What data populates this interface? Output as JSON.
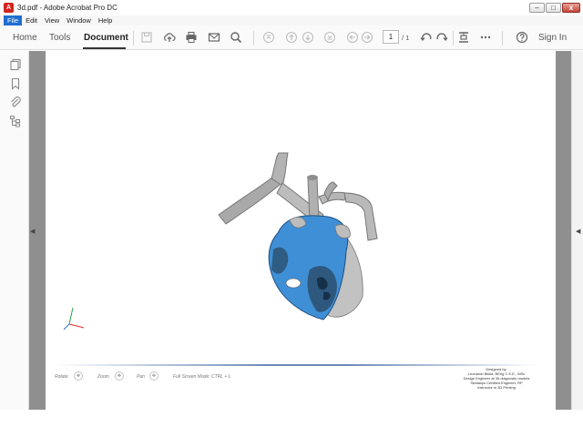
{
  "window": {
    "title": "3d.pdf - Adobe Acrobat Pro DC"
  },
  "menu": {
    "items": [
      "File",
      "Edit",
      "View",
      "Window",
      "Help"
    ]
  },
  "toolbar": {
    "home": "Home",
    "tools": "Tools",
    "document": "Document",
    "page_current": "1",
    "page_total": "/ 1",
    "signin": "Sign In"
  },
  "viewer": {
    "hints": {
      "rotate": "Rotate",
      "zoom": "Zoom",
      "pan": "Pan",
      "fullscreen": "Full Screen Mode: CTRL + L"
    },
    "credits": [
      "Designed by:",
      "Leonardo Bikila, BEng C.E.E., MSc",
      "Design Engineer at 3d diagnostic models",
      "Stratasys Certified Engineer, RP",
      "Instructor in 3D Printing"
    ]
  },
  "colors": {
    "accent": "#1f6fd0",
    "heart_blue": "#3f8fd6",
    "heart_grey": "#b9b9b9"
  }
}
